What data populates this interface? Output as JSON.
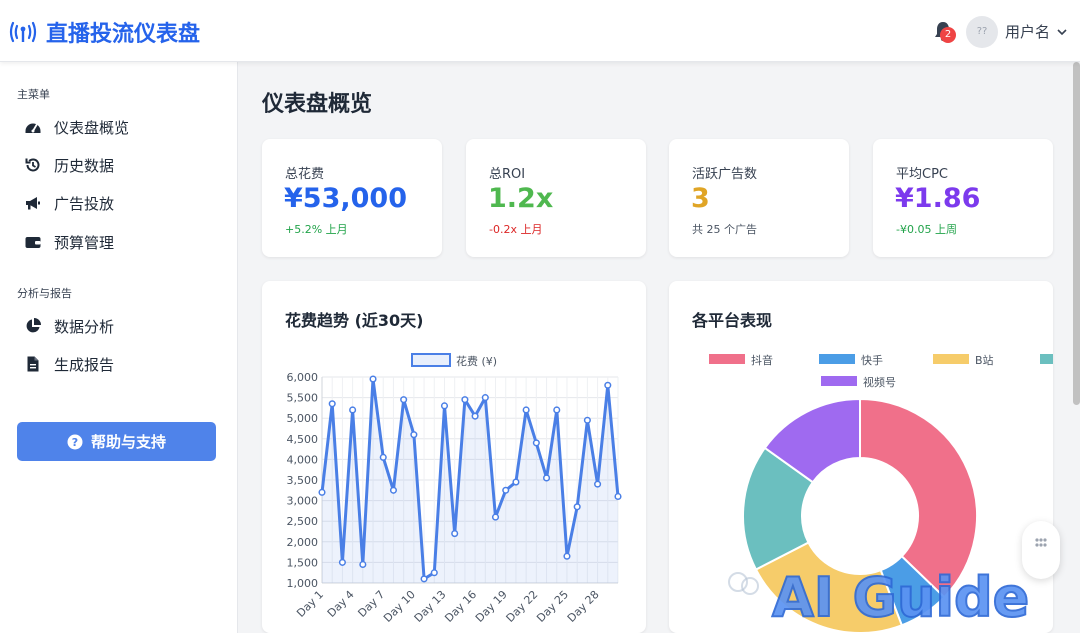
{
  "app": {
    "title": "直播投流仪表盘"
  },
  "header": {
    "notification_count": "2",
    "avatar_text": "??",
    "username": "用户名"
  },
  "sidebar": {
    "section_main": "主菜单",
    "main_items": [
      {
        "label": "仪表盘概览",
        "icon": "dashboard-icon"
      },
      {
        "label": "历史数据",
        "icon": "history-icon"
      },
      {
        "label": "广告投放",
        "icon": "megaphone-icon"
      },
      {
        "label": "预算管理",
        "icon": "wallet-icon"
      }
    ],
    "section_analysis": "分析与报告",
    "analysis_items": [
      {
        "label": "数据分析",
        "icon": "pie-chart-icon"
      },
      {
        "label": "生成报告",
        "icon": "file-icon"
      }
    ],
    "help_button": "帮助与支持"
  },
  "main": {
    "page_title": "仪表盘概览",
    "stats": [
      {
        "label": "总花费",
        "value": "¥53,000",
        "sub": "+5.2% 上月",
        "value_color": "#2563eb",
        "sub_color": "#22a34a"
      },
      {
        "label": "总ROI",
        "value": "1.2x",
        "sub": "-0.2x 上月",
        "value_color": "#4fb84f",
        "sub_color": "#dc2626"
      },
      {
        "label": "活跃广告数",
        "value": "3",
        "sub": "共 25 个广告",
        "value_color": "#e0a526",
        "sub_color": "#4b5563"
      },
      {
        "label": "平均CPC",
        "value": "¥1.86",
        "sub": "-¥0.05 上周",
        "value_color": "#7c3aed",
        "sub_color": "#22a34a"
      }
    ],
    "trend_title": "花费趋势 (近30天)",
    "platform_title": "各平台表现"
  },
  "chart_data": [
    {
      "type": "line",
      "title": "花费趋势 (近30天)",
      "x": [
        "Day 1",
        "Day 2",
        "Day 3",
        "Day 4",
        "Day 5",
        "Day 6",
        "Day 7",
        "Day 8",
        "Day 9",
        "Day 10",
        "Day 11",
        "Day 12",
        "Day 13",
        "Day 14",
        "Day 15",
        "Day 16",
        "Day 17",
        "Day 18",
        "Day 19",
        "Day 20",
        "Day 21",
        "Day 22",
        "Day 23",
        "Day 24",
        "Day 25",
        "Day 26",
        "Day 27",
        "Day 28",
        "Day 29",
        "Day 30"
      ],
      "x_tick_labels": [
        "Day 1",
        "Day 4",
        "Day 7",
        "Day 10",
        "Day 13",
        "Day 16",
        "Day 19",
        "Day 22",
        "Day 25",
        "Day 28"
      ],
      "series": [
        {
          "name": "花费 (¥)",
          "values": [
            3200,
            5350,
            1500,
            5200,
            1450,
            5950,
            4050,
            3250,
            5450,
            4600,
            1100,
            1250,
            5300,
            2200,
            5450,
            5050,
            5500,
            2600,
            3250,
            3450,
            5200,
            4400,
            3550,
            5200,
            1650,
            2850,
            4950,
            3400,
            5800,
            3100
          ],
          "color": "#4a7fe6"
        }
      ],
      "y_ticks": [
        "1,000",
        "1,500",
        "2,000",
        "2,500",
        "3,000",
        "3,500",
        "4,000",
        "4,500",
        "5,000",
        "5,500",
        "6,000"
      ],
      "ylim": [
        1000,
        6000
      ],
      "grid": true,
      "legend": "top-center"
    },
    {
      "type": "pie",
      "title": "各平台表现",
      "categories": [
        "抖音",
        "快手",
        "B站",
        "小红书",
        "视频号"
      ],
      "values": [
        32,
        6,
        20,
        15,
        13
      ],
      "colors": [
        "#f0708a",
        "#4b9de6",
        "#f6cc6a",
        "#6bbfbf",
        "#9f6af0"
      ],
      "legend": "top"
    }
  ]
}
